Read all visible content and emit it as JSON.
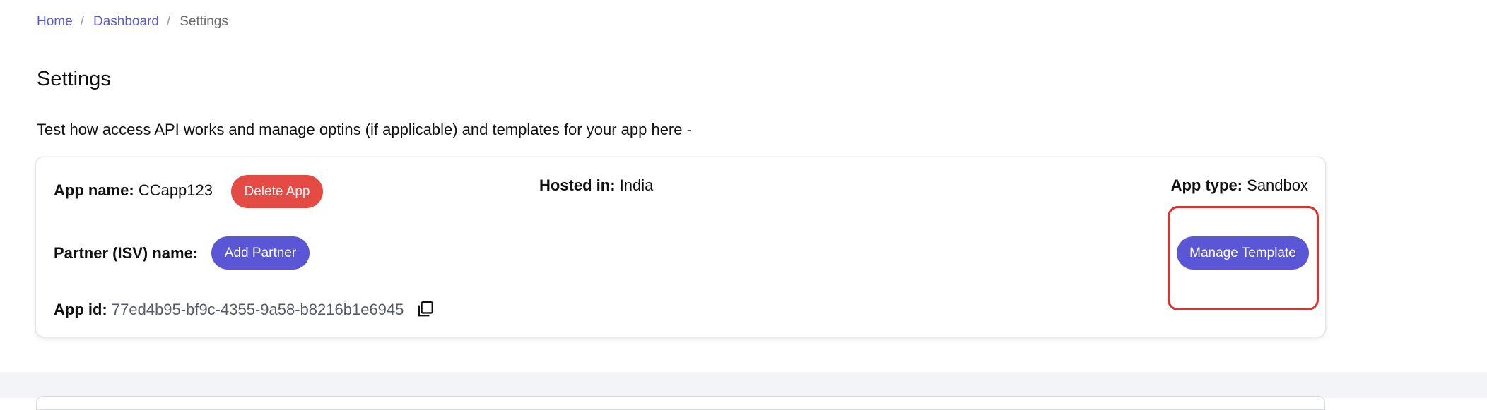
{
  "breadcrumb": {
    "items": [
      "Home",
      "Dashboard"
    ],
    "separator": "/",
    "current": "Settings"
  },
  "page": {
    "title": "Settings",
    "description": "Test how access API works and manage optins (if applicable) and templates for your app here -"
  },
  "app": {
    "name_label": "App name:",
    "name_value": "CCapp123",
    "delete_label": "Delete App",
    "hosted_label": "Hosted in:",
    "hosted_value": "India",
    "type_label": "App type:",
    "type_value": "Sandbox",
    "partner_label": "Partner (ISV) name:",
    "add_partner_label": "Add Partner",
    "manage_template_label": "Manage Template",
    "id_label": "App id:",
    "id_value": "77ed4b95-bf9c-4355-9a58-b8216b1e6945"
  },
  "icons": {
    "copy": "copy-icon"
  },
  "colors": {
    "link": "#5a57d4",
    "primary_button": "#5b56d6",
    "danger_button": "#e34b44",
    "highlight": "#e2312c",
    "page_bg_lower": "#f3f4f8"
  }
}
